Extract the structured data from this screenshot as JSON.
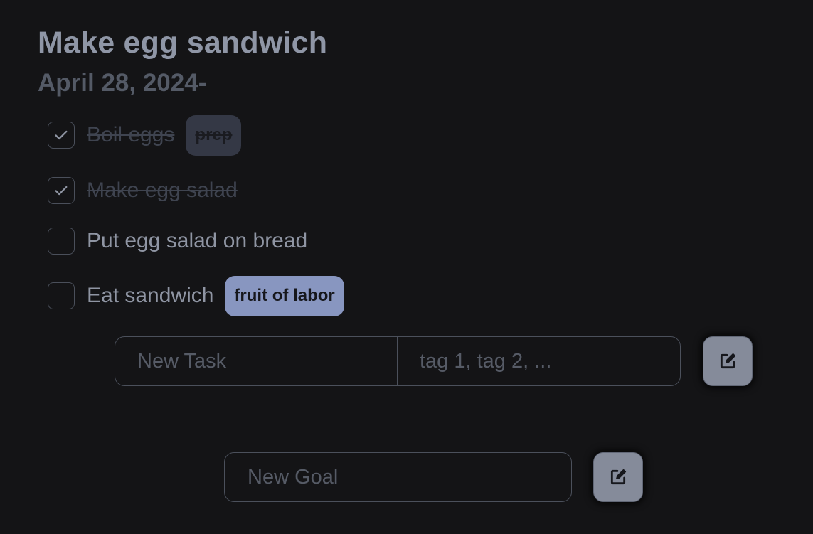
{
  "goal": {
    "title": "Make egg sandwich",
    "date": "April 28, 2024-"
  },
  "tasks": [
    {
      "label": "Boil eggs",
      "done": true,
      "tags": [
        "prep"
      ]
    },
    {
      "label": "Make egg salad",
      "done": true,
      "tags": []
    },
    {
      "label": "Put egg salad on bread",
      "done": false,
      "tags": []
    },
    {
      "label": "Eat sandwich",
      "done": false,
      "tags": [
        "fruit of labor"
      ]
    }
  ],
  "new_task": {
    "task_placeholder": "New Task",
    "task_value": "",
    "tags_placeholder": "tag 1, tag 2, ...",
    "tags_value": "",
    "submit_icon": "edit-icon"
  },
  "new_goal": {
    "placeholder": "New Goal",
    "value": "",
    "submit_icon": "edit-icon"
  },
  "colors": {
    "background": "#141416",
    "title": "#8f96a6",
    "date": "#545a66",
    "tag_active": "#8896c0",
    "tag_muted": "#343845",
    "button": "#858b9a"
  }
}
